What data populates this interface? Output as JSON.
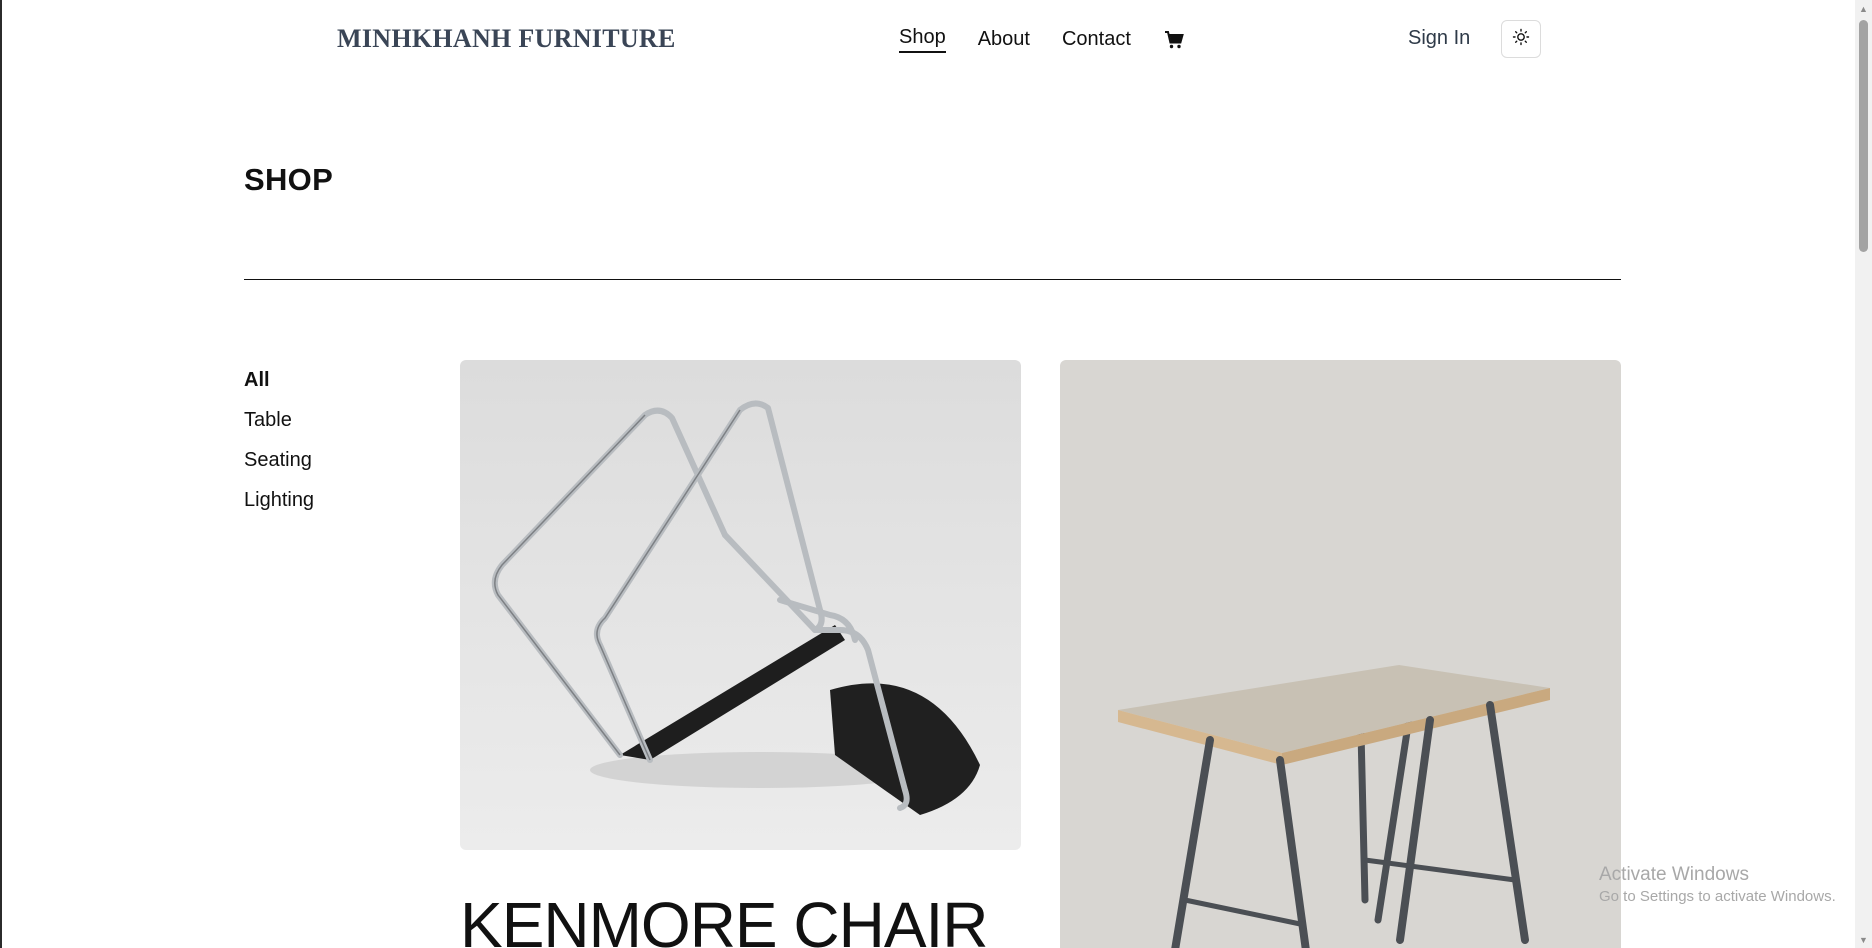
{
  "header": {
    "brand": "MINHKHANH FURNITURE",
    "nav": [
      {
        "label": "Shop"
      },
      {
        "label": "About"
      },
      {
        "label": "Contact"
      }
    ],
    "cart_icon": "shopping-cart-icon",
    "sign_in": "Sign In",
    "theme_icon": "sun-icon"
  },
  "page": {
    "title": "SHOP"
  },
  "categories": [
    {
      "label": "All",
      "active": true
    },
    {
      "label": "Table"
    },
    {
      "label": "Seating"
    },
    {
      "label": "Lighting"
    }
  ],
  "products": [
    {
      "name": "KENMORE CHAIR",
      "image": "chair-image"
    },
    {
      "name": "",
      "image": "table-image"
    }
  ],
  "watermark": {
    "line1": "Activate Windows",
    "line2": "Go to Settings to activate Windows."
  },
  "colors": {
    "brand": "#3a4556",
    "text": "#111111",
    "product_bg_1": "#e6e6e6",
    "product_bg_2": "#d8d6d2"
  }
}
